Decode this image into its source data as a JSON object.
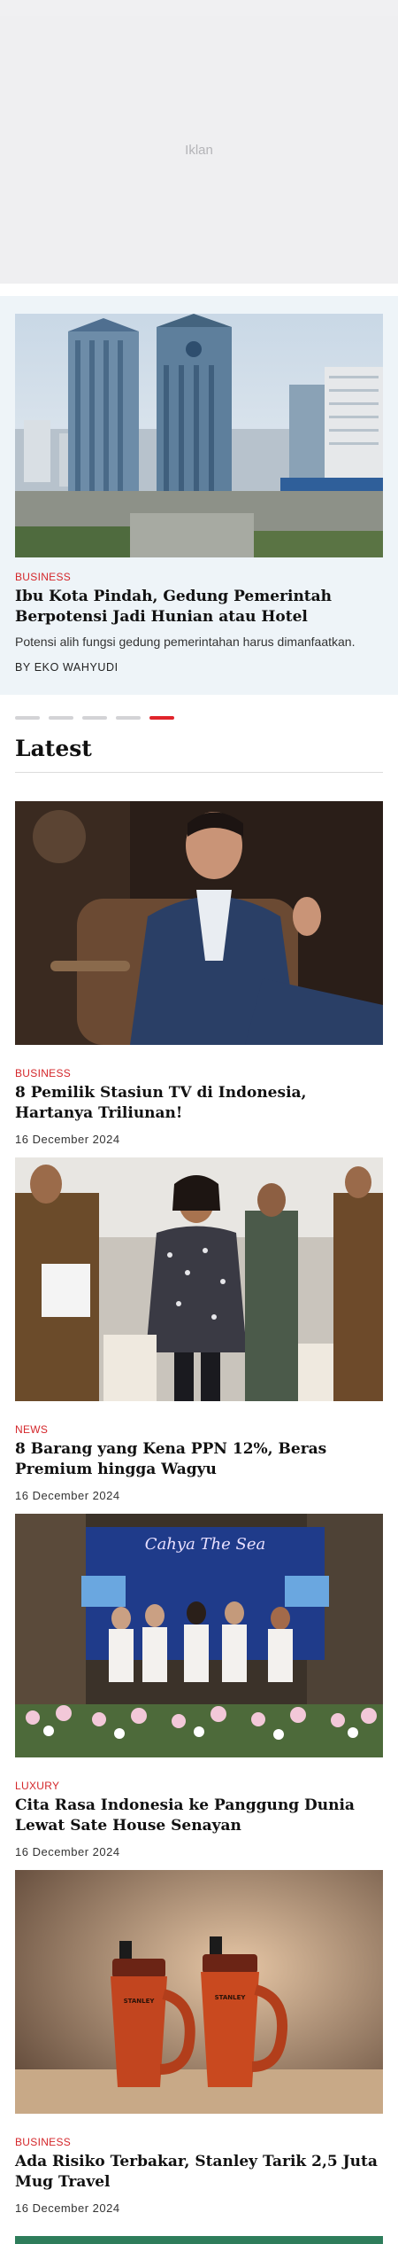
{
  "ad": {
    "label": "Iklan"
  },
  "featured": {
    "category": "BUSINESS",
    "title": "Ibu Kota Pindah, Gedung Pemerintah Berpotensi Jadi Hunian atau Hotel",
    "summary": "Potensi alih fungsi gedung pemerintahan harus dimanfaatkan.",
    "byline": "BY EKO WAHYUDI",
    "image_alt": "Government office towers in Jakarta"
  },
  "carousel": {
    "total": 5,
    "active_index": 4
  },
  "latest": {
    "title": "Latest",
    "articles": [
      {
        "category": "BUSINESS",
        "title": "8 Pemilik Stasiun TV di Indonesia, Hartanya Triliunan!",
        "date": "16 December 2024"
      },
      {
        "category": "NEWS",
        "title": "8 Barang yang Kena PPN 12%, Beras Premium hingga Wagyu",
        "date": "16 December 2024"
      },
      {
        "category": "LUXURY",
        "title": "Cita Rasa Indonesia ke Panggung Dunia Lewat Sate House Senayan",
        "date": "16 December 2024"
      },
      {
        "category": "BUSINESS",
        "title": "Ada Risiko Terbakar, Stanley Tarik 2,5 Juta Mug Travel",
        "date": "16 December 2024"
      }
    ]
  },
  "colors": {
    "accent": "#d4262a",
    "featured_bg": "#eef4f8",
    "ad_bg": "#efeff1"
  },
  "images": {
    "event_banner_text": "Cahya The Sea",
    "mug_brand": "STANLEY"
  }
}
